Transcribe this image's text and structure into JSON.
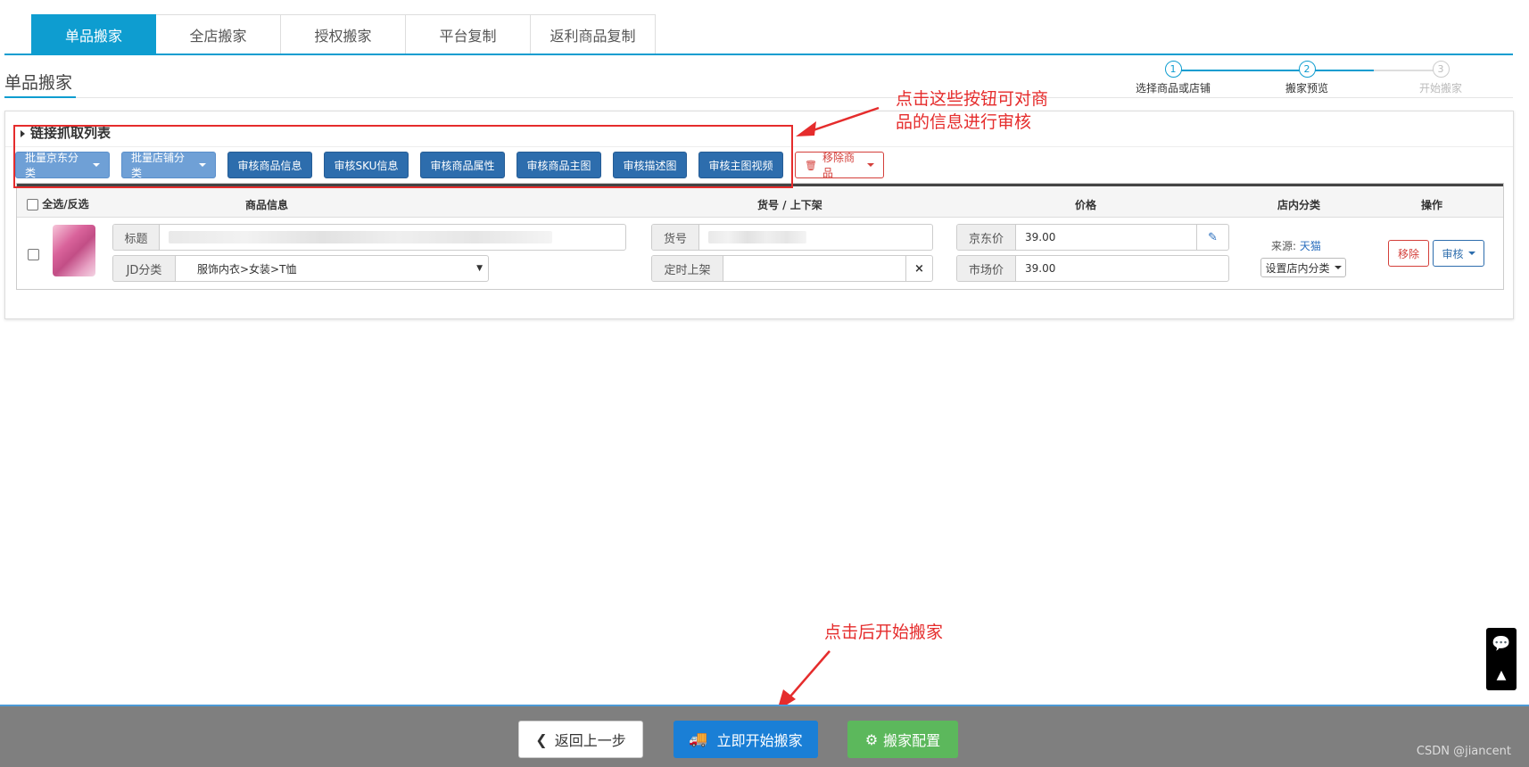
{
  "tabs": [
    "单品搬家",
    "全店搬家",
    "授权搬家",
    "平台复制",
    "返利商品复制"
  ],
  "page_title": "单品搬家",
  "steps": [
    {
      "num": "1",
      "label": "选择商品或店铺",
      "active": true
    },
    {
      "num": "2",
      "label": "搬家预览",
      "active": true
    },
    {
      "num": "3",
      "label": "开始搬家",
      "active": false
    }
  ],
  "panel": {
    "title": "链接抓取列表",
    "toolbar": {
      "batch_jd_category": "批量京东分类",
      "batch_shop_category": "批量店铺分类",
      "review_product_info": "审核商品信息",
      "review_sku_info": "审核SKU信息",
      "review_product_attrs": "审核商品属性",
      "review_main_image": "审核商品主图",
      "review_desc_image": "审核描述图",
      "review_main_video": "审核主图视频",
      "remove_products": "移除商品"
    }
  },
  "table": {
    "headers": {
      "select_all": "全选/反选",
      "product_info": "商品信息",
      "sku_shelf": "货号 / 上下架",
      "price": "价格",
      "shop_category": "店内分类",
      "actions": "操作"
    },
    "row": {
      "title_label": "标题",
      "jd_category_label": "JD分类",
      "jd_category_value": "服饰内衣>女装>T恤",
      "sku_label": "货号",
      "schedule_label": "定时上架",
      "jd_price_label": "京东价",
      "jd_price_value": "39.00",
      "market_price_label": "市场价",
      "market_price_value": "39.00",
      "source_label": "来源:",
      "source_value": "天猫",
      "set_shop_category": "设置店内分类",
      "remove": "移除",
      "review": "审核",
      "clear_symbol": "×"
    }
  },
  "annotations": {
    "review_buttons_note_line1": "点击这些按钮可对商",
    "review_buttons_note_line2": "品的信息进行审核",
    "start_note": "点击后开始搬家"
  },
  "bottom_bar": {
    "back": "返回上一步",
    "start": "立即开始搬家",
    "config": "搬家配置"
  },
  "watermark": "CSDN @jiancent",
  "colors": {
    "accent": "#0e9dd0",
    "primary_button": "#1a7fd6",
    "success_button": "#5cb85c",
    "annotation_red": "#e52c2c"
  }
}
